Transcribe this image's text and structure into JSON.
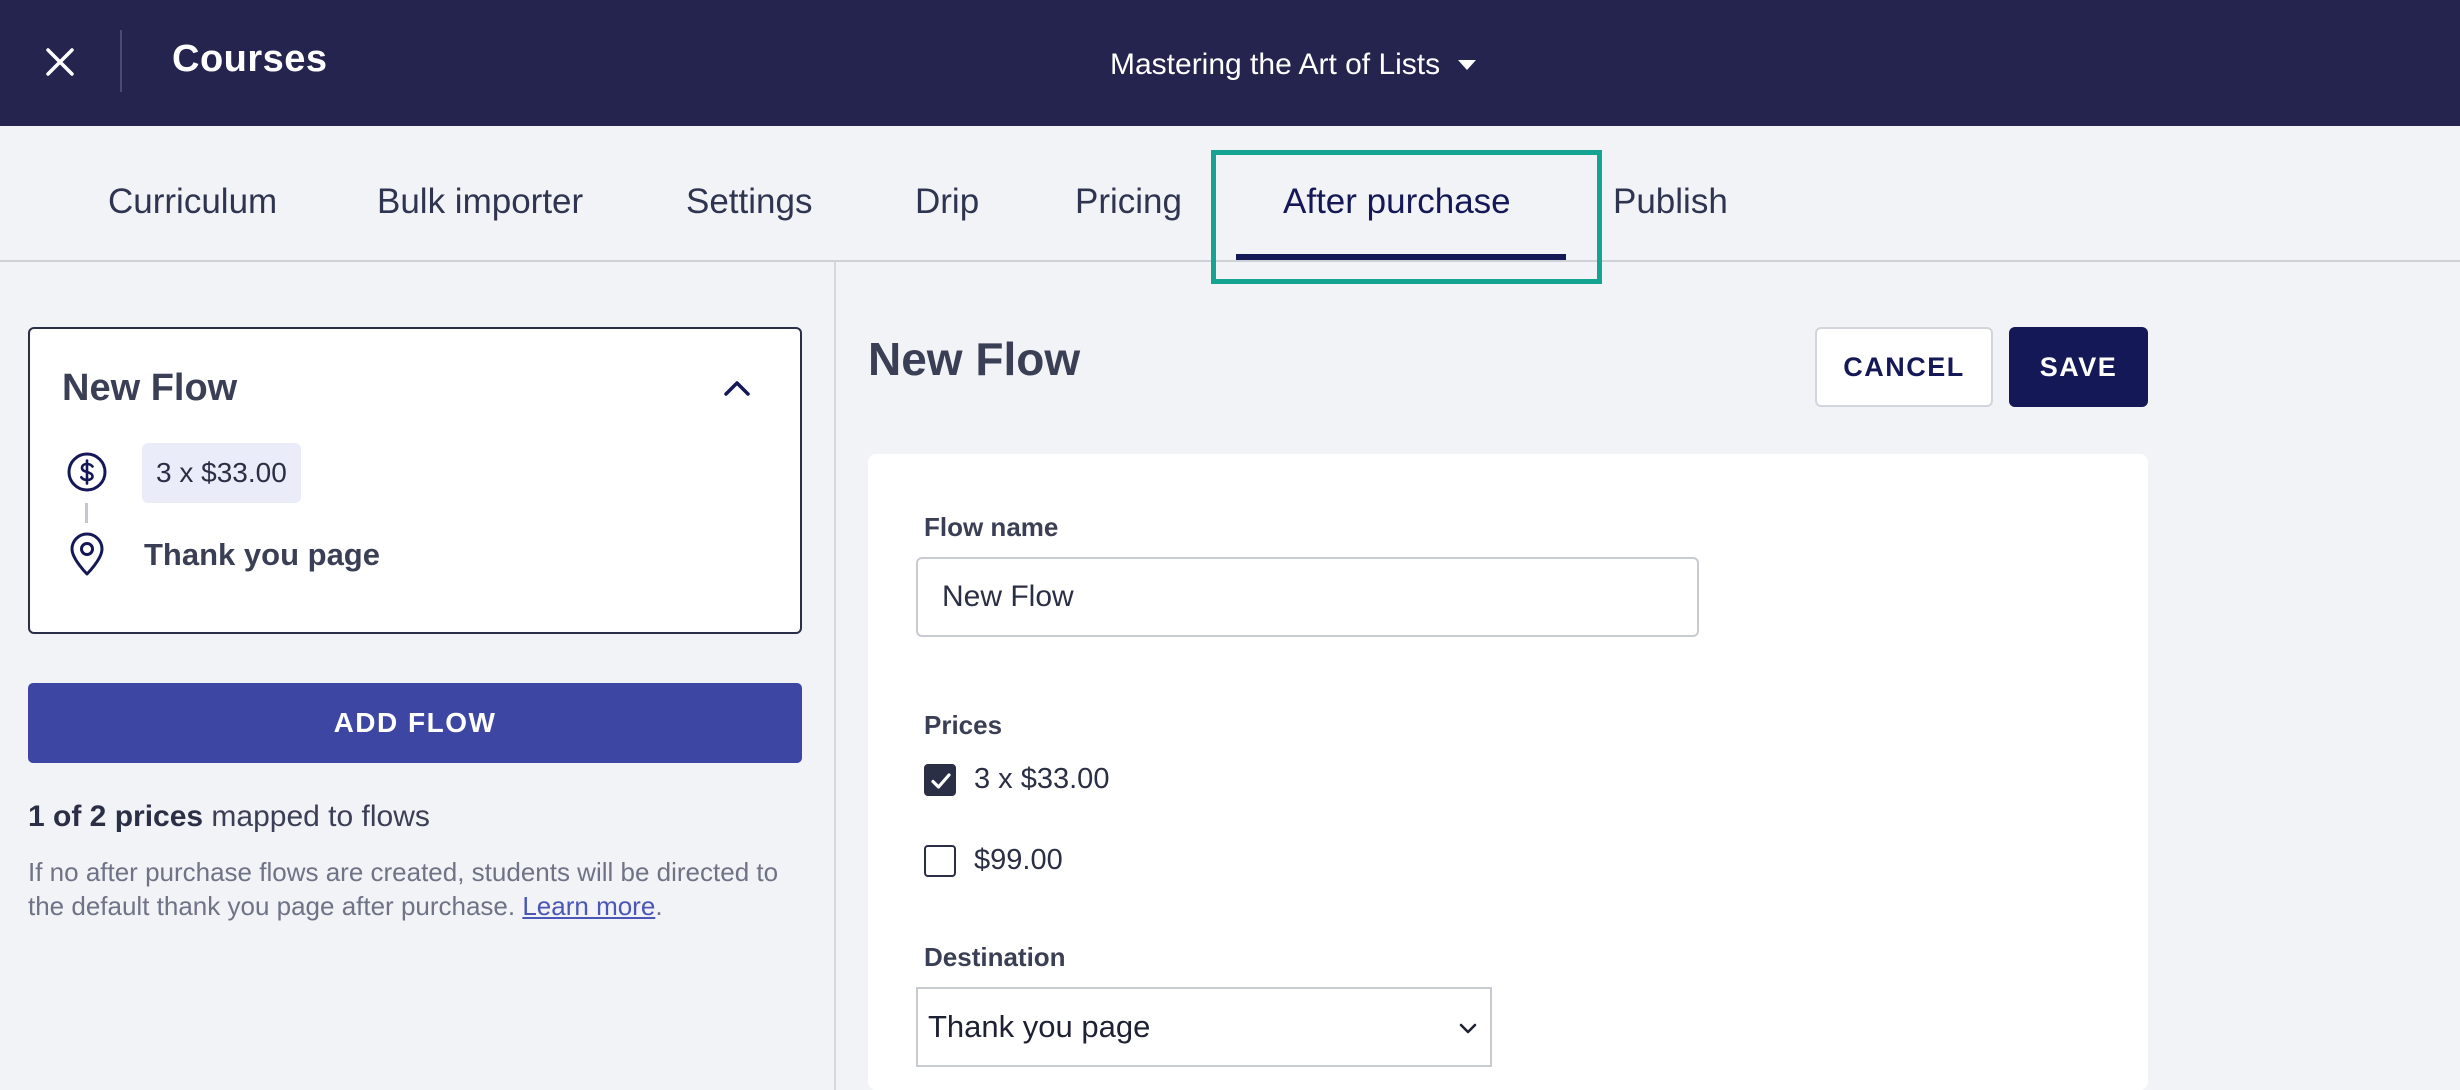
{
  "header": {
    "app_title": "Courses",
    "course_name": "Mastering the Art of Lists"
  },
  "tabs": [
    {
      "label": "Curriculum"
    },
    {
      "label": "Bulk importer"
    },
    {
      "label": "Settings"
    },
    {
      "label": "Drip"
    },
    {
      "label": "Pricing"
    },
    {
      "label": "After purchase",
      "active": true
    },
    {
      "label": "Publish"
    }
  ],
  "sidebar": {
    "flow_card": {
      "title": "New Flow",
      "price_chip": "3 x $33.00",
      "destination": "Thank you page"
    },
    "add_flow_label": "ADD FLOW",
    "mapped_count": "1 of 2 prices",
    "mapped_suffix": " mapped to flows",
    "hint_text": "If no after purchase flows are created, students will be directed to the default thank you page after purchase. ",
    "hint_link": "Learn more",
    "hint_end": "."
  },
  "form": {
    "title": "New Flow",
    "cancel_label": "CANCEL",
    "save_label": "SAVE",
    "flow_name_label": "Flow name",
    "flow_name_value": "New Flow",
    "prices_label": "Prices",
    "prices": [
      {
        "label": "3 x $33.00",
        "checked": true
      },
      {
        "label": "$99.00",
        "checked": false
      }
    ],
    "destination_label": "Destination",
    "destination_value": "Thank you page"
  },
  "colors": {
    "topbar": "#25244f",
    "primary": "#151856",
    "add_button": "#3d46a3",
    "highlight": "#15a491"
  },
  "icons": [
    "close-icon",
    "chevron-down-icon",
    "chevron-up-icon",
    "dollar-icon",
    "map-pin-icon",
    "checkmark-icon"
  ]
}
